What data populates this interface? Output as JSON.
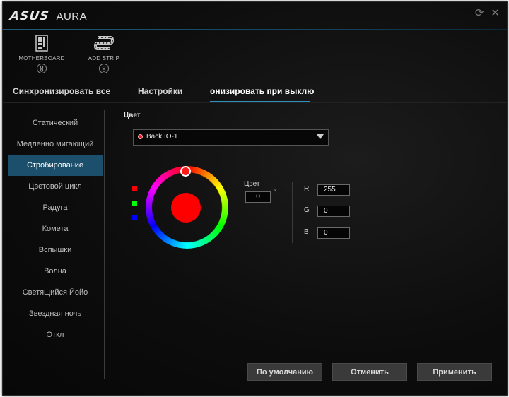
{
  "window": {
    "brand": "ASUS",
    "title": "AURA",
    "icons": [
      "refresh-icon",
      "close-icon"
    ]
  },
  "devices": [
    {
      "label": "MOTHERBOARD",
      "icon": "motherboard-icon",
      "badge": "8"
    },
    {
      "label": "ADD STRIP",
      "icon": "led-strip-icon",
      "badge": "8"
    }
  ],
  "tabs": [
    {
      "label": "Синхронизировать все"
    },
    {
      "label": "Настройки"
    },
    {
      "label": "онизировать при выклю",
      "active": true
    }
  ],
  "sidebar": {
    "items": [
      {
        "label": "Статический"
      },
      {
        "label": "Медленно мигающий"
      },
      {
        "label": "Стробирование",
        "active": true
      },
      {
        "label": "Цветовой цикл"
      },
      {
        "label": "Радуга"
      },
      {
        "label": "Комета"
      },
      {
        "label": "Вспышки"
      },
      {
        "label": "Волна"
      },
      {
        "label": "Светящийся Йойо"
      },
      {
        "label": "Звездная ночь"
      },
      {
        "label": "Откл"
      }
    ]
  },
  "main": {
    "color_label": "Цвет",
    "zone_select": {
      "value": "Back IO-1",
      "dot_color": "#e81919"
    },
    "presets": [
      {
        "color": "#ff0000"
      },
      {
        "color": "#00ff00"
      },
      {
        "color": "#0000ff"
      }
    ],
    "selected_color": "#ff0000",
    "hue": {
      "label": "Цвет",
      "value": "0",
      "unit": "°"
    },
    "rgb": [
      {
        "label": "R",
        "value": "255"
      },
      {
        "label": "G",
        "value": "0"
      },
      {
        "label": "B",
        "value": "0"
      }
    ]
  },
  "buttons": {
    "default": "По умолчанию",
    "cancel": "Отменить",
    "apply": "Применить"
  },
  "colors": {
    "accent": "#2f8fc0",
    "sidebar_active": "#1c4f6b",
    "background": "#0d0d0d"
  }
}
